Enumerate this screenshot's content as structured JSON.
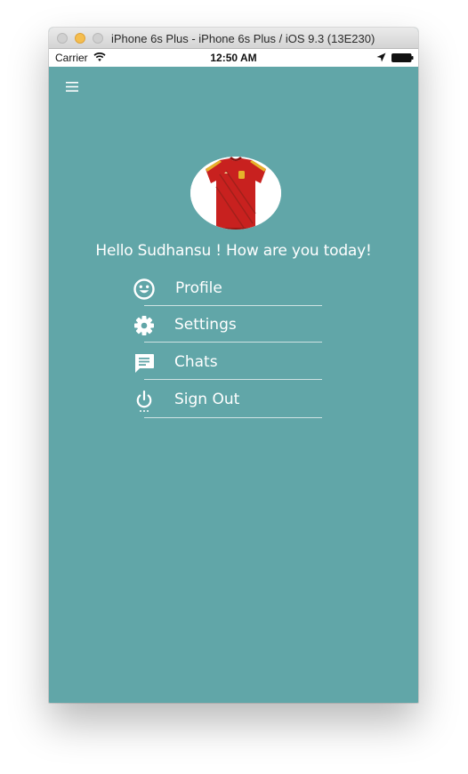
{
  "window": {
    "title": "iPhone 6s Plus - iPhone 6s Plus / iOS 9.3 (13E230)"
  },
  "status_bar": {
    "carrier": "Carrier",
    "time": "12:50 AM"
  },
  "header": {
    "menu_icon": "hamburger-icon"
  },
  "profile": {
    "avatar_description": "red-jersey-image",
    "greeting": "Hello Sudhansu ! How are you today!"
  },
  "menu": {
    "items": [
      {
        "label": "Profile",
        "icon": "smiley-icon"
      },
      {
        "label": "Settings",
        "icon": "gear-icon"
      },
      {
        "label": "Chats",
        "icon": "chat-icon"
      },
      {
        "label": "Sign Out",
        "icon": "power-icon"
      }
    ]
  },
  "colors": {
    "background": "#61a6a8",
    "text": "#ffffff",
    "separator": "#cfe3e3"
  }
}
